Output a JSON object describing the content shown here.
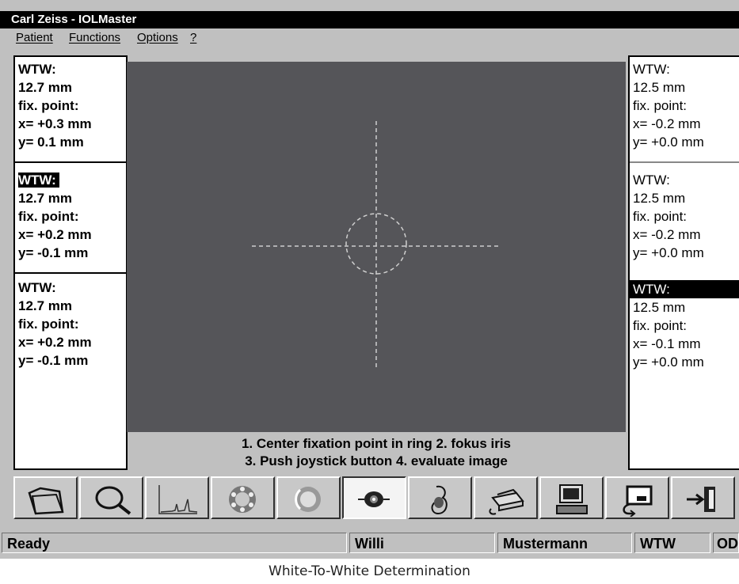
{
  "window": {
    "title": "Carl Zeiss - IOLMaster"
  },
  "menu": {
    "items": [
      "Patient",
      "Functions",
      "Options",
      "?"
    ]
  },
  "left_measurements": [
    {
      "label": "WTW:",
      "value": "12.7 mm",
      "fix_label": "fix. point:",
      "x": "x= +0.3 mm",
      "y": "y=  0.1 mm",
      "selected": false
    },
    {
      "label": "WTW:",
      "value": "12.7 mm",
      "fix_label": "fix. point:",
      "x": "x= +0.2 mm",
      "y": "y= -0.1 mm",
      "selected": true
    },
    {
      "label": "WTW:",
      "value": "12.7 mm",
      "fix_label": "fix. point:",
      "x": "x= +0.2 mm",
      "y": "y= -0.1 mm",
      "selected": false
    }
  ],
  "right_measurements": [
    {
      "label": "WTW:",
      "value": "12.5 mm",
      "fix_label": "fix. point:",
      "x": "x= -0.2 mm",
      "y": "y= +0.0 mm",
      "selected": false
    },
    {
      "label": "WTW:",
      "value": "12.5 mm",
      "fix_label": "fix. point:",
      "x": "x= -0.2 mm",
      "y": "y= +0.0 mm",
      "selected": false
    },
    {
      "label": "WTW:",
      "value": "12.5 mm",
      "fix_label": "fix. point:",
      "x": "x= -0.1 mm",
      "y": "y= +0.0 mm",
      "selected": true
    }
  ],
  "instructions": {
    "line1": "1. Center fixation point in ring 2. fokus iris",
    "line2": "3. Push joystick button 4. evaluate image"
  },
  "toolbar": {
    "buttons": [
      {
        "icon": "folder-icon",
        "pressed": false
      },
      {
        "icon": "magnifier-icon",
        "pressed": false
      },
      {
        "icon": "chart-icon",
        "pressed": false
      },
      {
        "icon": "ring-icon",
        "pressed": false
      },
      {
        "icon": "lens-icon",
        "pressed": false
      },
      {
        "icon": "eye-icon",
        "pressed": true
      },
      {
        "icon": "hand-icon",
        "pressed": false
      },
      {
        "icon": "printer-icon",
        "pressed": false
      },
      {
        "icon": "computer-icon",
        "pressed": false
      },
      {
        "icon": "export-icon",
        "pressed": false
      },
      {
        "icon": "exit-icon",
        "pressed": false
      }
    ]
  },
  "status": {
    "state": "Ready",
    "first_name": "Willi",
    "last_name": "Mustermann",
    "mode": "WTW",
    "eye": "OD"
  },
  "caption": "White-To-White Determination"
}
